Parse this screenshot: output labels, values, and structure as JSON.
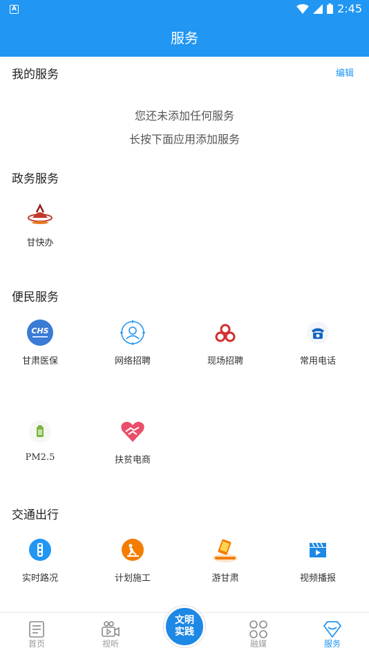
{
  "status": {
    "time": "2:45",
    "left_icon": "A"
  },
  "appbar": {
    "title": "服务"
  },
  "my_services": {
    "title": "我的服务",
    "edit": "编辑",
    "empty_line1": "您还未添加任何服务",
    "empty_line2": "长按下面应用添加服务"
  },
  "gov": {
    "title": "政务服务",
    "items": [
      {
        "label": "甘快办",
        "icon": "gan-kuai-ban-logo-icon"
      }
    ]
  },
  "people": {
    "title": "便民服务",
    "items": [
      {
        "label": "甘肃医保",
        "icon": "chs-medical-insurance-icon"
      },
      {
        "label": "网络招聘",
        "icon": "online-recruit-icon"
      },
      {
        "label": "现场招聘",
        "icon": "onsite-recruit-icon"
      },
      {
        "label": "常用电话",
        "icon": "telephone-icon"
      },
      {
        "label": "PM2.5",
        "icon": "pm25-icon"
      },
      {
        "label": "扶贫电商",
        "icon": "poverty-ecommerce-icon"
      }
    ]
  },
  "traffic": {
    "title": "交通出行",
    "items": [
      {
        "label": "实时路况",
        "icon": "traffic-light-icon"
      },
      {
        "label": "计划施工",
        "icon": "construction-icon"
      },
      {
        "label": "游甘肃",
        "icon": "travel-gansu-icon"
      },
      {
        "label": "视频播报",
        "icon": "video-broadcast-icon"
      }
    ]
  },
  "tabs": {
    "home": "首页",
    "video": "视听",
    "center_top": "文明",
    "center_bottom": "实践",
    "media": "融媒",
    "service": "服务"
  },
  "colors": {
    "primary": "#2196f3",
    "orange": "#f57c00",
    "pink": "#e94f6a"
  }
}
